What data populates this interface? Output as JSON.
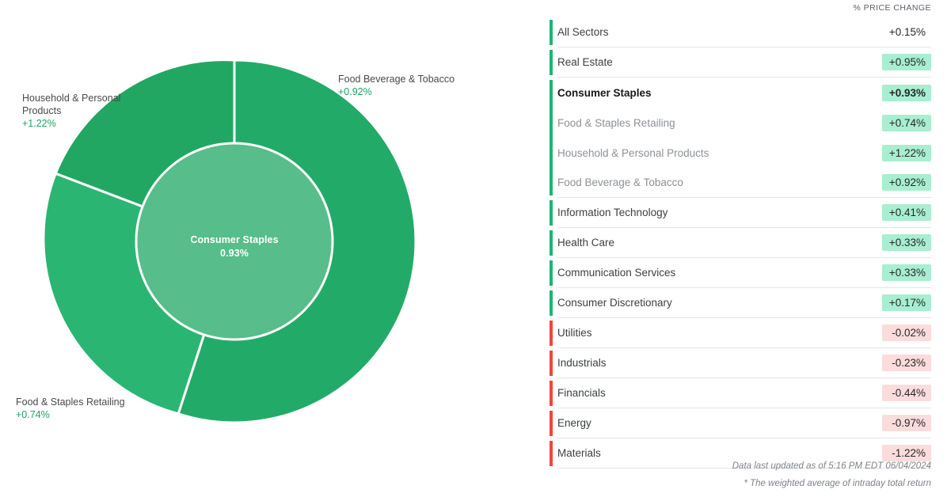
{
  "list": {
    "header_label": "% PRICE CHANGE",
    "rows": [
      {
        "label": "All Sectors",
        "value": "+0.15%",
        "tone": "plain",
        "bar": "#1fb573",
        "level": 0,
        "bold": false,
        "group_start": true,
        "group_end": true
      },
      {
        "label": "Real Estate",
        "value": "+0.95%",
        "tone": "pos",
        "bar": "#1fb573",
        "level": 0,
        "bold": false,
        "group_start": true,
        "group_end": true
      },
      {
        "label": "Consumer Staples",
        "value": "+0.93%",
        "tone": "pos",
        "bar": "#1fb573",
        "level": 0,
        "bold": true,
        "group_start": true,
        "group_end": false
      },
      {
        "label": "Food & Staples Retailing",
        "value": "+0.74%",
        "tone": "pos",
        "bar": "#1fb573",
        "level": 1,
        "bold": false,
        "group_start": false,
        "group_end": false
      },
      {
        "label": "Household & Personal Products",
        "value": "+1.22%",
        "tone": "pos",
        "bar": "#1fb573",
        "level": 1,
        "bold": false,
        "group_start": false,
        "group_end": false
      },
      {
        "label": "Food Beverage & Tobacco",
        "value": "+0.92%",
        "tone": "pos",
        "bar": "#1fb573",
        "level": 1,
        "bold": false,
        "group_start": false,
        "group_end": true
      },
      {
        "label": "Information Technology",
        "value": "+0.41%",
        "tone": "pos",
        "bar": "#1fb573",
        "level": 0,
        "bold": false,
        "group_start": true,
        "group_end": true
      },
      {
        "label": "Health Care",
        "value": "+0.33%",
        "tone": "pos",
        "bar": "#1fb573",
        "level": 0,
        "bold": false,
        "group_start": true,
        "group_end": true
      },
      {
        "label": "Communication Services",
        "value": "+0.33%",
        "tone": "pos",
        "bar": "#1fb573",
        "level": 0,
        "bold": false,
        "group_start": true,
        "group_end": true
      },
      {
        "label": "Consumer Discretionary",
        "value": "+0.17%",
        "tone": "pos",
        "bar": "#1fb573",
        "level": 0,
        "bold": false,
        "group_start": true,
        "group_end": true
      },
      {
        "label": "Utilities",
        "value": "-0.02%",
        "tone": "neg",
        "bar": "#f4443c",
        "level": 0,
        "bold": false,
        "group_start": true,
        "group_end": true
      },
      {
        "label": "Industrials",
        "value": "-0.23%",
        "tone": "neg",
        "bar": "#f4443c",
        "level": 0,
        "bold": false,
        "group_start": true,
        "group_end": true
      },
      {
        "label": "Financials",
        "value": "-0.44%",
        "tone": "neg",
        "bar": "#f4443c",
        "level": 0,
        "bold": false,
        "group_start": true,
        "group_end": true
      },
      {
        "label": "Energy",
        "value": "-0.97%",
        "tone": "neg",
        "bar": "#f4443c",
        "level": 0,
        "bold": false,
        "group_start": true,
        "group_end": true
      },
      {
        "label": "Materials",
        "value": "-1.22%",
        "tone": "neg",
        "bar": "#f4443c",
        "level": 0,
        "bold": false,
        "group_start": true,
        "group_end": true
      }
    ]
  },
  "footnotes": {
    "line1": "Data last updated as of 5:16 PM EDT 06/04/2024",
    "line2": "* The weighted average of intraday total return"
  },
  "chart_data": {
    "type": "pie",
    "title": "",
    "center": {
      "label": "Consumer Staples",
      "value": "0.93%"
    },
    "inner_ring": [
      {
        "name": "Consumer Staples",
        "value": 0.93,
        "share": 100,
        "color": "#57bd8a"
      }
    ],
    "outer_ring": [
      {
        "name": "Food Beverage & Tobacco",
        "value": 0.92,
        "share": 55.0,
        "color": "#22ab68",
        "label_value": "+0.92%"
      },
      {
        "name": "Food & Staples Retailing",
        "value": 0.74,
        "share": 26.0,
        "color": "#22ab68",
        "label_value": "+0.74%"
      },
      {
        "name": "Household & Personal Products",
        "value": 1.22,
        "share": 19.0,
        "color": "#22ab68",
        "label_value": "+1.22%"
      }
    ],
    "labels": [
      {
        "name": "Household & Personal Products",
        "text_line1": "Household & Personal",
        "text_line2": "Products",
        "value": "+1.22%"
      },
      {
        "name": "Food Beverage & Tobacco",
        "text_line1": "Food Beverage & Tobacco",
        "text_line2": "",
        "value": "+0.92%"
      },
      {
        "name": "Food & Staples Retailing",
        "text_line1": "Food & Staples Retailing",
        "text_line2": "",
        "value": "+0.74%"
      }
    ],
    "legend_position": "right-list",
    "grid": false
  },
  "colors": {
    "positive_chip": "#a8eed0",
    "negative_chip": "#fbdcdc",
    "positive_bar": "#1fb573",
    "negative_bar": "#f4443c",
    "outer_ring": "#22ab68",
    "inner_ring": "#57bd8a",
    "label_green": "#1fa363"
  }
}
